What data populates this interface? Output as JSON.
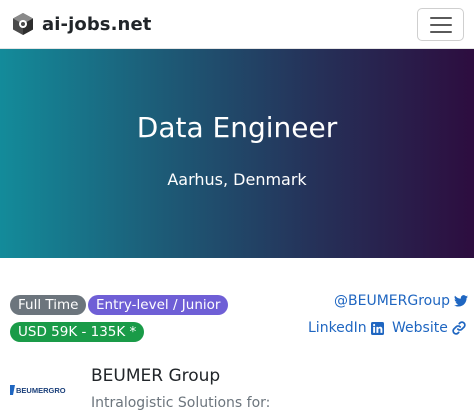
{
  "navbar": {
    "brand": "ai-jobs.net",
    "logo_icon": "gear-cube-icon",
    "menu_icon": "hamburger-icon"
  },
  "hero": {
    "title": "Data Engineer",
    "location": "Aarhus, Denmark",
    "gradient": [
      "#138b9a",
      "#2d0d3f"
    ]
  },
  "badges": {
    "employment_type": "Full Time",
    "level": "Entry-level / Junior",
    "salary": "USD 59K - 135K *"
  },
  "links": {
    "twitter": "@BEUMERGroup",
    "linkedin": "LinkedIn",
    "website": "Website"
  },
  "company": {
    "logo_text": "BEUMERGROUP",
    "name": "BEUMER Group",
    "description": "Intralogistic Solutions for:"
  },
  "colors": {
    "link": "#1f66c1",
    "badge_grey": "#6c757d",
    "badge_purple": "#6f5fd6",
    "badge_green": "#1a9b48"
  }
}
